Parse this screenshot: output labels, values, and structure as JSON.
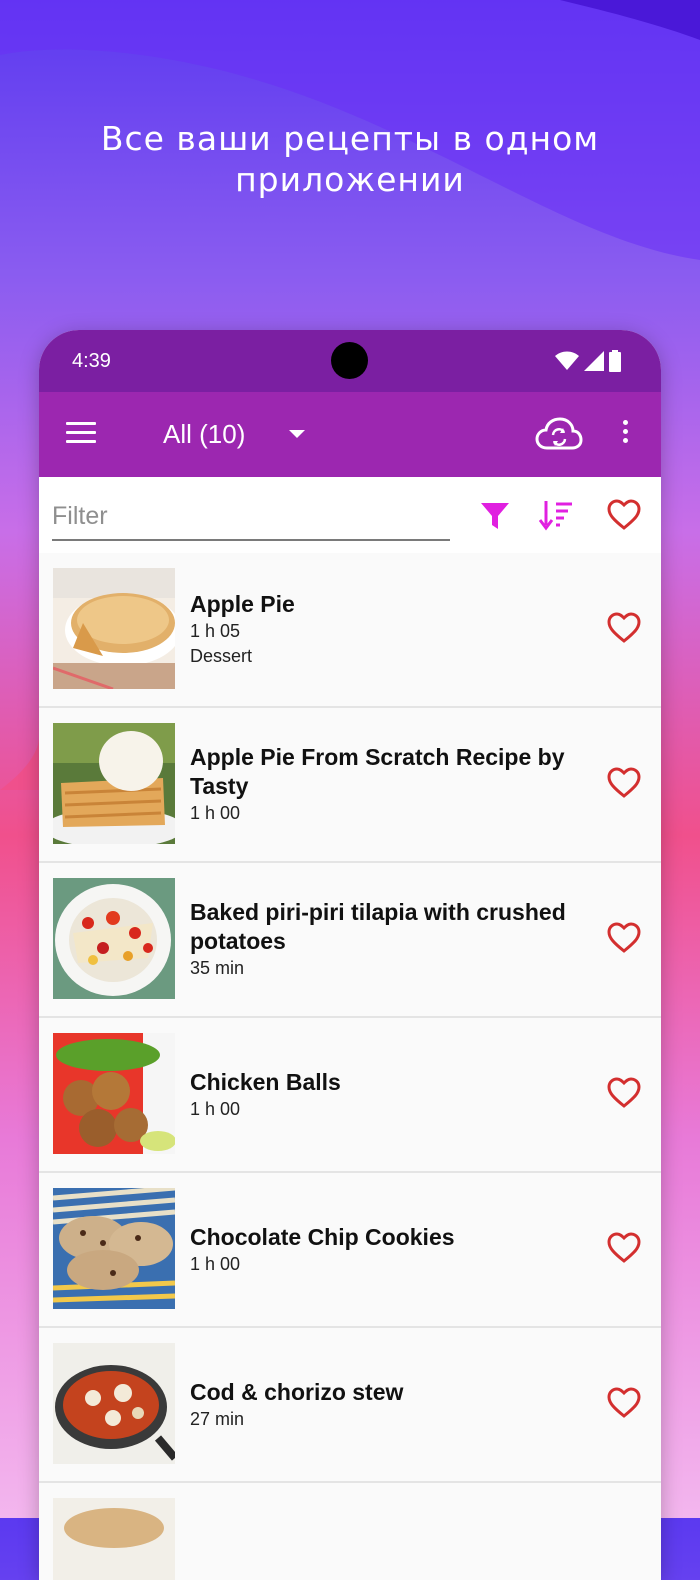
{
  "promo": {
    "headline_line1": "Все ваши рецепты в одном",
    "headline_line2": "приложении"
  },
  "status_bar": {
    "time": "4:39"
  },
  "app_bar": {
    "category": "All (10)",
    "icons": {
      "menu": "hamburger-menu-icon",
      "dropdown": "arrow-drop-down-icon",
      "sync": "cloud-sync-icon",
      "more": "more-vertical-icon"
    }
  },
  "filter_bar": {
    "placeholder": "Filter",
    "value": "",
    "icons": {
      "filter": "funnel-icon",
      "sort": "sort-icon",
      "favorites": "heart-outline-icon"
    }
  },
  "colors": {
    "status_bar": "#7b1fa2",
    "app_bar": "#9c27b0",
    "accent": "#e040fb",
    "heart": "#d32f2f"
  },
  "recipes": [
    {
      "title": "Apple Pie",
      "time": "1 h 05",
      "category": "Dessert",
      "image": "apple-pie-photo"
    },
    {
      "title": "Apple Pie From Scratch Recipe by Tasty",
      "time": "1 h 00",
      "category": "",
      "image": "apple-pie-ice-cream-photo"
    },
    {
      "title": "Baked piri-piri tilapia with crushed potatoes",
      "time": "35 min",
      "category": "",
      "image": "tilapia-photo"
    },
    {
      "title": "Chicken Balls",
      "time": "1 h 00",
      "category": "",
      "image": "chicken-balls-photo"
    },
    {
      "title": "Chocolate Chip Cookies",
      "time": "1 h 00",
      "category": "",
      "image": "cookies-photo"
    },
    {
      "title": "Cod & chorizo stew",
      "time": "27 min",
      "category": "",
      "image": "cod-stew-photo"
    }
  ]
}
